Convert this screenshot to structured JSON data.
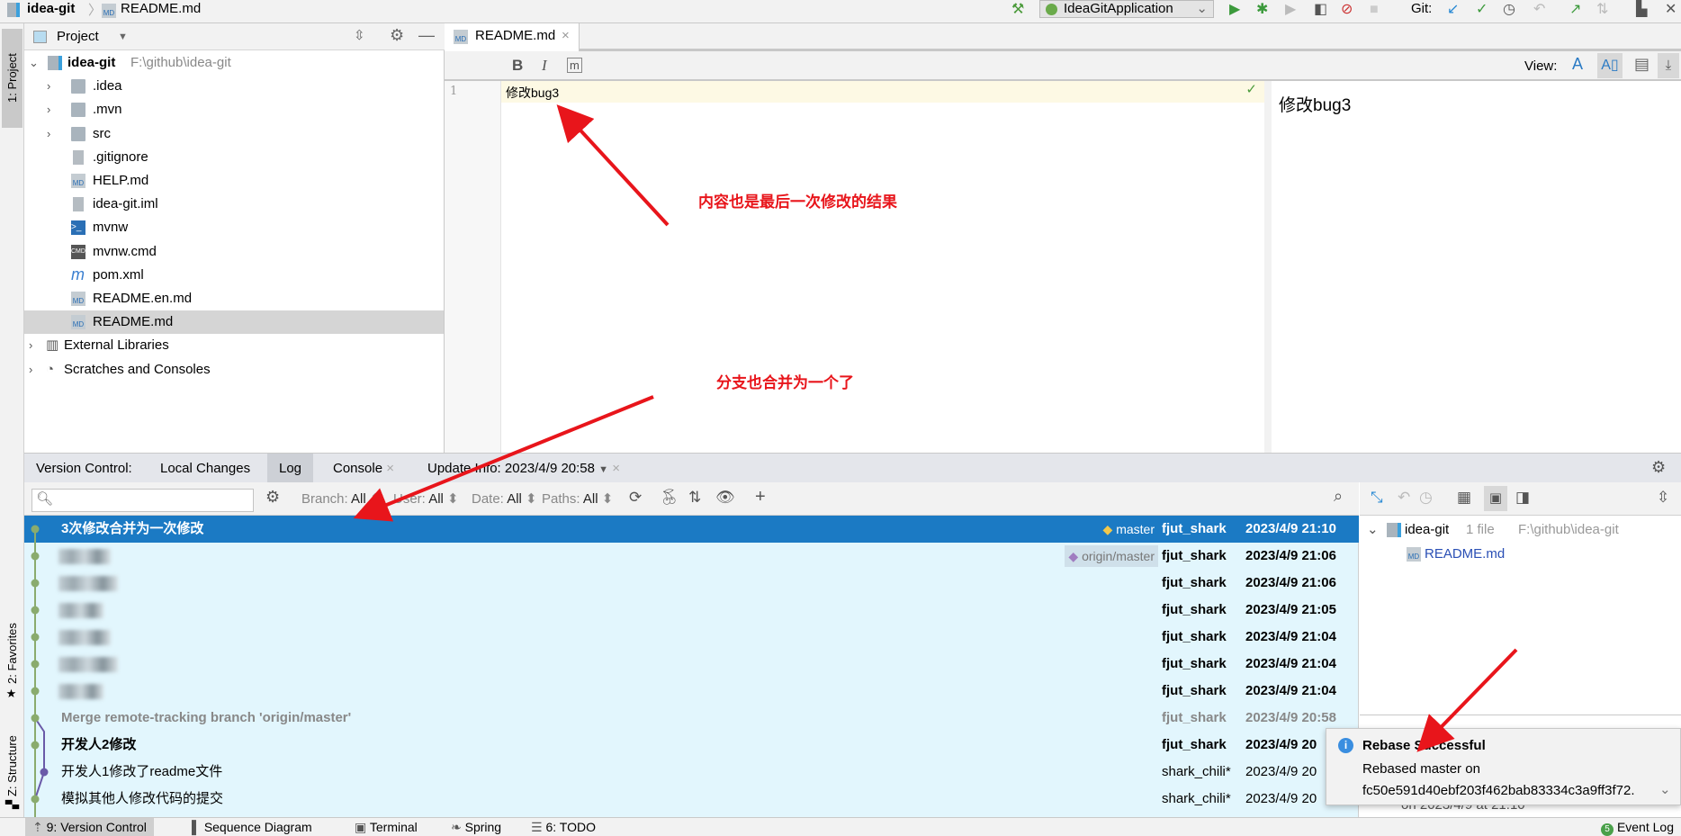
{
  "breadcrumb": {
    "project": "idea-git",
    "file": "README.md"
  },
  "toolbar": {
    "run_config": "IdeaGitApplication",
    "git_label": "Git:"
  },
  "left_strip": {
    "project": "1: Project",
    "favorites": "2: Favorites",
    "structure": "Z: Structure"
  },
  "project_panel": {
    "title": "Project",
    "root": {
      "name": "idea-git",
      "path": "F:\\github\\idea-git"
    },
    "items": [
      {
        "name": ".idea",
        "type": "folder"
      },
      {
        "name": ".mvn",
        "type": "folder"
      },
      {
        "name": "src",
        "type": "folder"
      },
      {
        "name": ".gitignore",
        "type": "file"
      },
      {
        "name": "HELP.md",
        "type": "md"
      },
      {
        "name": "idea-git.iml",
        "type": "file"
      },
      {
        "name": "mvnw",
        "type": "shell"
      },
      {
        "name": "mvnw.cmd",
        "type": "cmd"
      },
      {
        "name": "pom.xml",
        "type": "maven"
      },
      {
        "name": "README.en.md",
        "type": "md"
      },
      {
        "name": "README.md",
        "type": "md",
        "selected": true
      }
    ],
    "external": "External Libraries",
    "scratches": "Scratches and Consoles"
  },
  "editor": {
    "tab": "README.md",
    "md_toolbar": {
      "bold": "B",
      "italic": "I",
      "code": "m"
    },
    "view_label": "View:",
    "line_number": "1",
    "content": "修改bug3",
    "preview": "修改bug3"
  },
  "annotations": {
    "content_note": "内容也是最后一次修改的结果",
    "branch_note": "分支也合并为一个了",
    "color": "#e8151b"
  },
  "version_control": {
    "label": "Version Control:",
    "tabs": [
      {
        "label": "Local Changes"
      },
      {
        "label": "Log",
        "active": true
      },
      {
        "label": "Console"
      },
      {
        "label": "Update Info: 2023/4/9 20:58"
      }
    ],
    "filters": {
      "branch": "Branch:",
      "branch_v": "All",
      "user": "User:",
      "user_v": "All",
      "date": "Date:",
      "date_v": "All",
      "paths": "Paths:",
      "paths_v": "All"
    },
    "commits": [
      {
        "message": "3次修改合并为一次修改",
        "ref": "master",
        "author": "fjut_shark",
        "date": "2023/4/9 21:10",
        "style": "selected"
      },
      {
        "message": "",
        "blurred": true,
        "ref": "origin/master",
        "author": "fjut_shark",
        "date": "2023/4/9 21:06",
        "style": "bold"
      },
      {
        "message": "",
        "blurred": true,
        "author": "fjut_shark",
        "date": "2023/4/9 21:06",
        "style": "bold"
      },
      {
        "message": "",
        "blurred": true,
        "author": "fjut_shark",
        "date": "2023/4/9 21:05",
        "style": "bold"
      },
      {
        "message": "",
        "blurred": true,
        "author": "fjut_shark",
        "date": "2023/4/9 21:04",
        "style": "bold"
      },
      {
        "message": "",
        "blurred": true,
        "author": "fjut_shark",
        "date": "2023/4/9 21:04",
        "style": "bold"
      },
      {
        "message": "",
        "blurred": true,
        "author": "fjut_shark",
        "date": "2023/4/9 21:04",
        "style": "bold"
      },
      {
        "message": "Merge remote-tracking branch 'origin/master'",
        "author": "fjut_shark",
        "date": "2023/4/9 20:58",
        "style": "grey"
      },
      {
        "message": "开发人2修改",
        "author": "fjut_shark",
        "date": "2023/4/9 20",
        "style": "bold"
      },
      {
        "message": "开发人1修改了readme文件",
        "author": "shark_chili*",
        "date": "2023/4/9 20",
        "style": "normal"
      },
      {
        "message": "模拟其他人修改代码的提交",
        "author": "shark_chili*",
        "date": "2023/4/9 20",
        "style": "normal"
      }
    ],
    "changes": {
      "root": "idea-git",
      "count": "1 file",
      "path": "F:\\github\\idea-git",
      "file": "README.md",
      "details": "on 2023/4/9 at 21:10"
    }
  },
  "notification": {
    "title": "Rebase Successful",
    "line1": "Rebased master on",
    "line2": "fc50e591d40ebf203f462bab83334c3a9ff3f72."
  },
  "statusbar": {
    "items": [
      "9: Version Control",
      "Sequence Diagram",
      "Terminal",
      "Spring",
      "6: TODO"
    ],
    "event_log": "Event Log",
    "event_count": "5"
  },
  "colors": {
    "selection": "#1b7ac4",
    "log_bg": "#e2f6fd",
    "graph_main": "#8aab6e",
    "graph_branch": "#6a5aa8",
    "accent_blue": "#2a6fb5"
  }
}
